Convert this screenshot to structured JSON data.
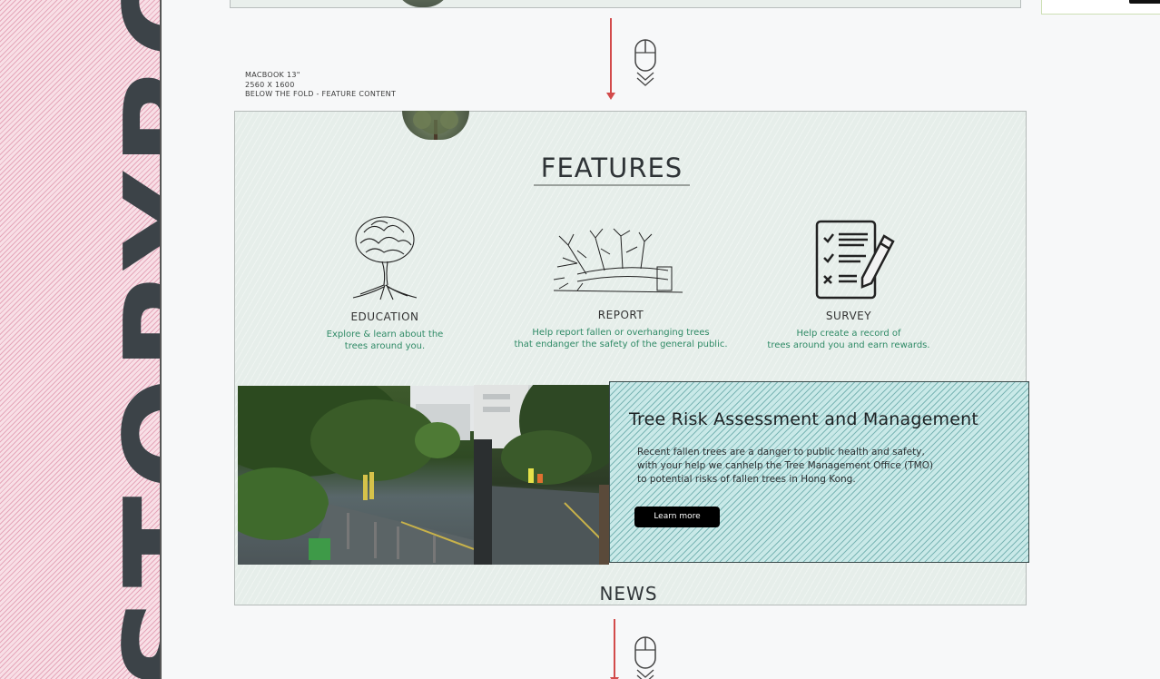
{
  "banner": {
    "text": "STORYBOARD"
  },
  "meta": {
    "device": "MACBOOK 13\"",
    "resolution": "2560 X 1600",
    "section": "BELOW THE FOLD - FEATURE CONTENT"
  },
  "features": {
    "title": "FEATURES",
    "items": [
      {
        "icon": "tree-icon",
        "title": "EDUCATION",
        "desc_line1": "Explore & learn about the",
        "desc_line2": "trees around you."
      },
      {
        "icon": "fallen-tree-icon",
        "title": "REPORT",
        "desc_line1": "Help report fallen or overhanging trees",
        "desc_line2": "that endanger the safety of the general public."
      },
      {
        "icon": "checklist-icon",
        "title": "SURVEY",
        "desc_line1": "Help create a record of",
        "desc_line2": "trees around you and earn rewards."
      }
    ]
  },
  "cta": {
    "title": "Tree Risk Assessment and Management",
    "body_line1": "Recent fallen trees are a danger to public health and safety,",
    "body_line2": "with your help we canhelp the Tree Management Office (TMO)",
    "body_line3": "to potential risks of fallen trees in Hong Kong.",
    "button_label": "Learn more"
  },
  "news": {
    "title": "NEWS"
  },
  "colors": {
    "banner_pink": "#f8dfe6",
    "arrow_red": "#d24b4b",
    "feature_green": "#2f8a66",
    "cta_teal": "#c9e9e8",
    "frame_bg": "#e6eeea"
  }
}
